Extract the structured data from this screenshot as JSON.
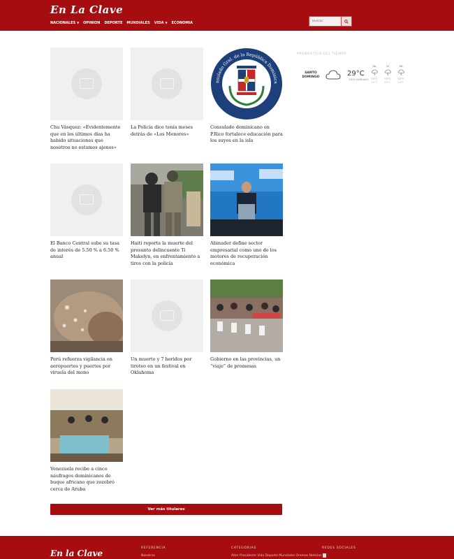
{
  "header": {
    "logo": "En La Clave",
    "nav": [
      {
        "label": "NACIONALES",
        "caret": true
      },
      {
        "label": "OPINION",
        "caret": false
      },
      {
        "label": "DEPORTE",
        "caret": false
      },
      {
        "label": "MUNDIALES",
        "caret": false
      },
      {
        "label": "VIDA",
        "caret": true
      },
      {
        "label": "ECONOMIA",
        "caret": false
      }
    ],
    "search_placeholder": "Buscar",
    "brand_color": "#a50d10"
  },
  "articles": [
    {
      "title": "Chu Vásquez: «Evidentemente que en los últimos días ha habido situaciones que nosotros no estamos ajenos»",
      "image": "placeholder"
    },
    {
      "title": "La Policía dice tenía meses detrás de «Los Menores»",
      "image": "placeholder"
    },
    {
      "title": "Consulado dominicano en P.Rico fortalece educación para los suyos en la isla",
      "image": "consulado-seal",
      "seal_top": "Consulado Gral. de la República Dominicana",
      "seal_bottom": "En San Juan, PR"
    },
    {
      "title": "El Banco Central sube su tasa de interés de 5.50 % a 6.50 % anual",
      "image": "placeholder"
    },
    {
      "title": "Haití reporta la muerte del presunto delincuente Ti Makelyn, en enfrentamiento a tiros con la policía",
      "image": "police-photo"
    },
    {
      "title": "Abinader define sector empresarial como uno de los motores de recuperación económica",
      "image": "speaker-photo"
    },
    {
      "title": "Perú refuerza vigilancia en aeropuertos y puertos por viruela del mono",
      "image": "skin-photo"
    },
    {
      "title": "Un muerto y 7 heridos por tiroteo en un festival en Oklahoma",
      "image": "placeholder"
    },
    {
      "title": "Gobierno en las provincias, un “viaje” de promesas",
      "image": "meeting-photo"
    },
    {
      "title": "Venezuela recibe a cinco náufragos dominicanos de buque africano que zozobró cerca de Aruba",
      "image": "room-photo"
    }
  ],
  "more_button": "Ver más titulares",
  "weather": {
    "title": "PRONÓSTICO DEL TIEMPO",
    "city": "SANTO DOMINGO",
    "temp": "29°C",
    "desc": "CIELO NUBLADO",
    "days": [
      {
        "day": "SA",
        "hi": "33°C",
        "lo": "25°C",
        "icon": "thunder-icon"
      },
      {
        "day": "VI",
        "hi": "33°C",
        "lo": "25°C",
        "icon": "thunder-icon"
      },
      {
        "day": "SÁ",
        "hi": "32°C",
        "lo": "25°C",
        "icon": "thunder-icon"
      }
    ]
  },
  "footer": {
    "logo": "En la Clave",
    "col1_title": "REFERENCIA",
    "col1_sub": "Nosotros",
    "col2_title": "CATEGORIAS",
    "col2_sub": "Alter Presidente Vida Deporte Mundiales Oramas Noticias",
    "col3_title": "REDES SOCIALES"
  }
}
